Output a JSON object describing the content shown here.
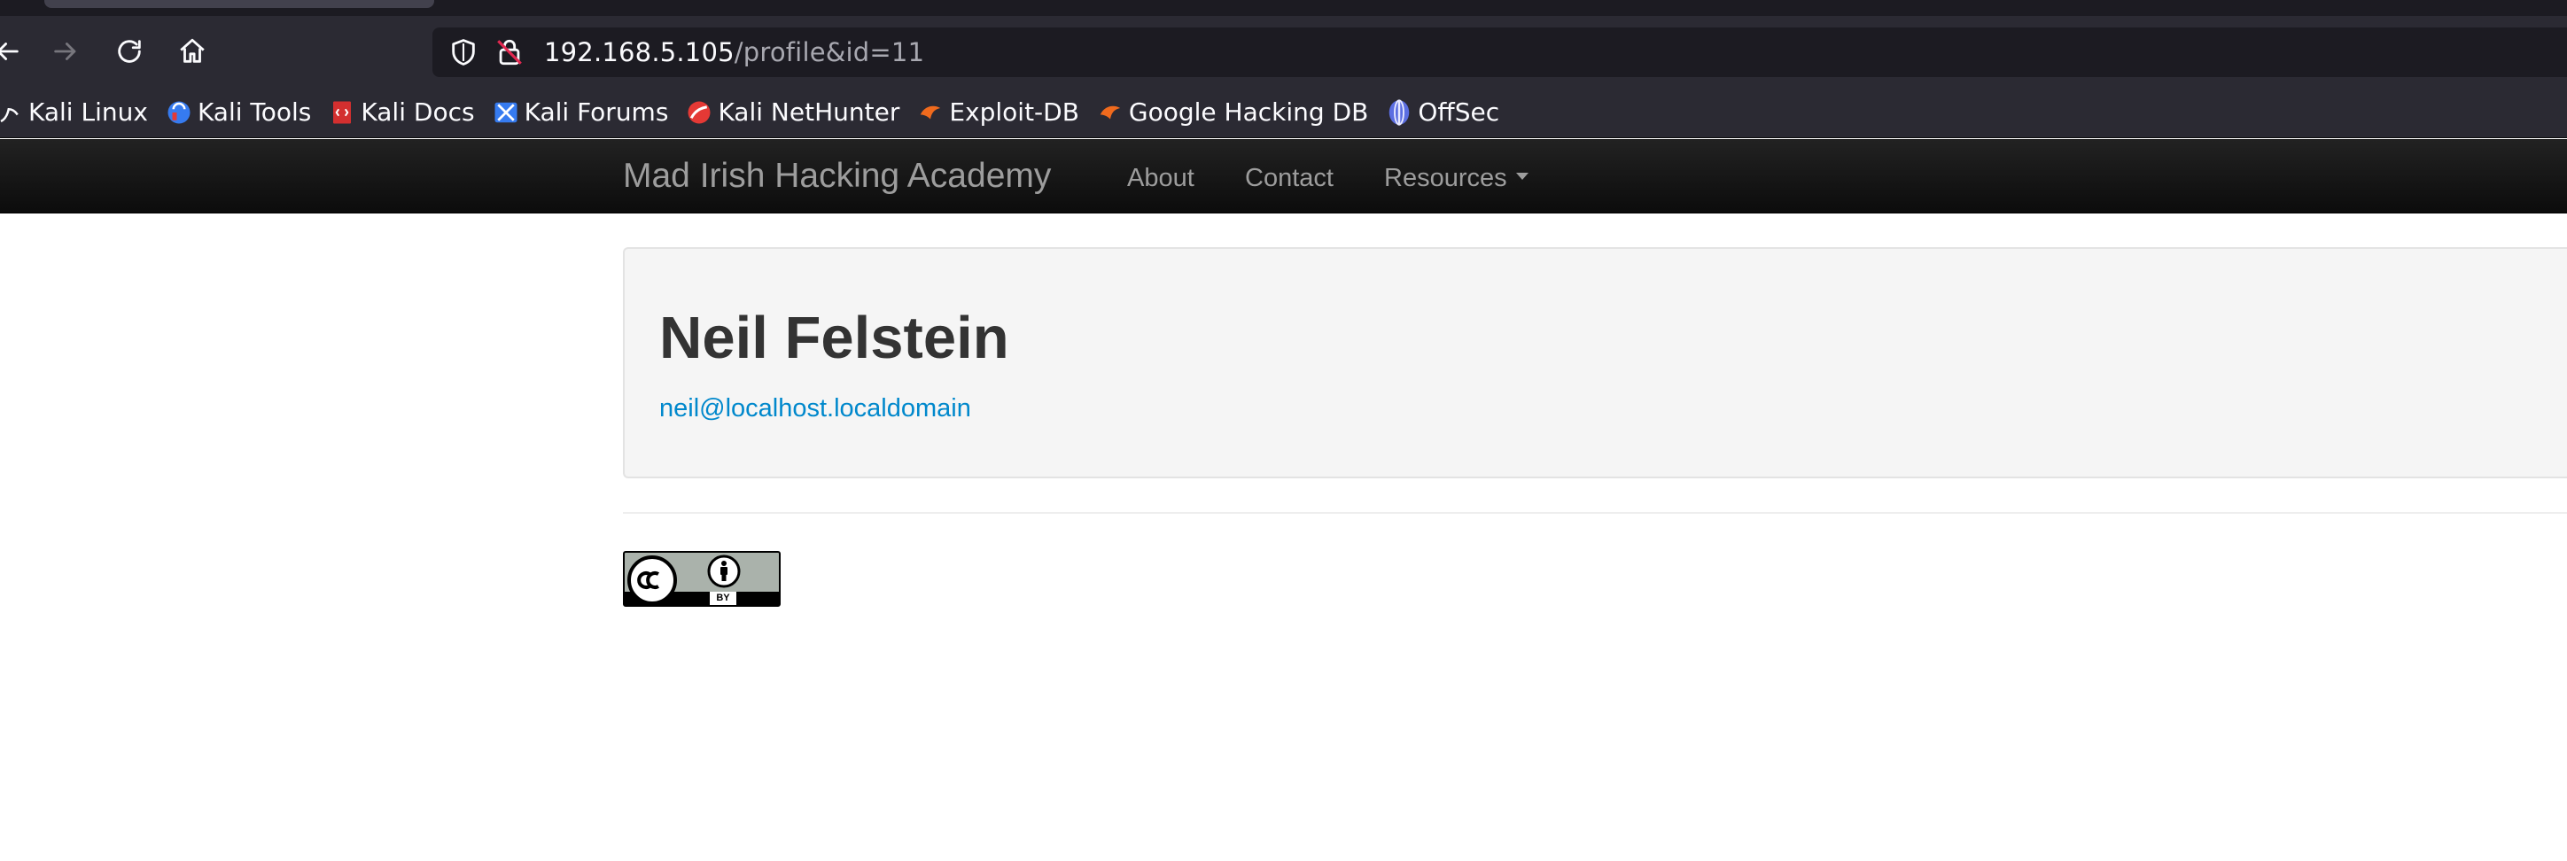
{
  "browser": {
    "url": {
      "host": "192.168.5.105",
      "path": "/profile&id=11"
    },
    "bookmarks": [
      {
        "label": "Kali Linux",
        "icon": "kali-dragon-icon"
      },
      {
        "label": "Kali Tools",
        "icon": "kali-tools-icon"
      },
      {
        "label": "Kali Docs",
        "icon": "kali-docs-icon"
      },
      {
        "label": "Kali Forums",
        "icon": "kali-forums-icon"
      },
      {
        "label": "Kali NetHunter",
        "icon": "kali-nethunter-icon"
      },
      {
        "label": "Exploit-DB",
        "icon": "exploit-db-icon"
      },
      {
        "label": "Google Hacking DB",
        "icon": "google-hacking-db-icon"
      },
      {
        "label": "OffSec",
        "icon": "offsec-icon"
      }
    ],
    "colors": {
      "chrome": "#2b2a33",
      "urlbar": "#1c1b22",
      "text": "#fbfbfe"
    }
  },
  "site": {
    "brand": "Mad Irish Hacking Academy",
    "nav": {
      "about": "About",
      "contact": "Contact",
      "resources": "Resources"
    }
  },
  "profile": {
    "name": "Neil Felstein",
    "email": "neil@localhost.localdomain"
  },
  "footer": {
    "license_badge": {
      "icon": "creative-commons-by-icon",
      "text": "BY"
    }
  },
  "colors": {
    "navbar": "#111111",
    "link": "#0088cc",
    "hero_bg": "#f5f5f5",
    "heading": "#333333"
  }
}
